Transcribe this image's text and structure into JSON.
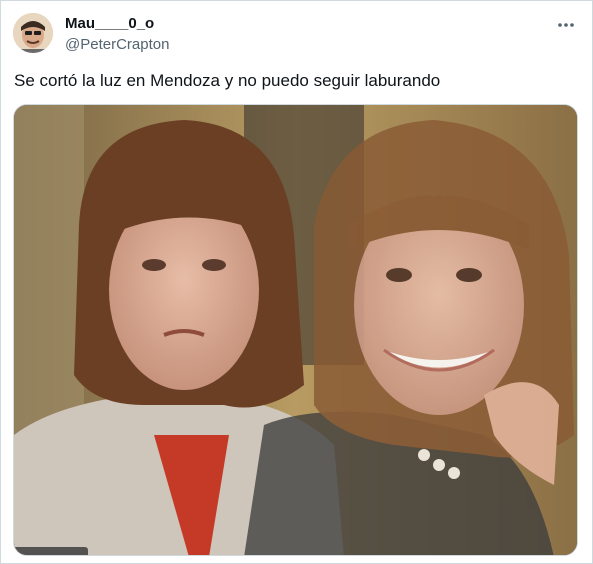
{
  "tweet": {
    "author_name": "Mau____0_o",
    "author_handle": "@PeterCrapton",
    "text": "Se cortó la luz en Mendoza y no puedo seguir laburando"
  },
  "icons": {
    "more": "more-options-icon",
    "avatar": "avatar"
  },
  "colors": {
    "text_primary": "#0f1419",
    "text_secondary": "#536471",
    "border": "#cfd9de"
  }
}
